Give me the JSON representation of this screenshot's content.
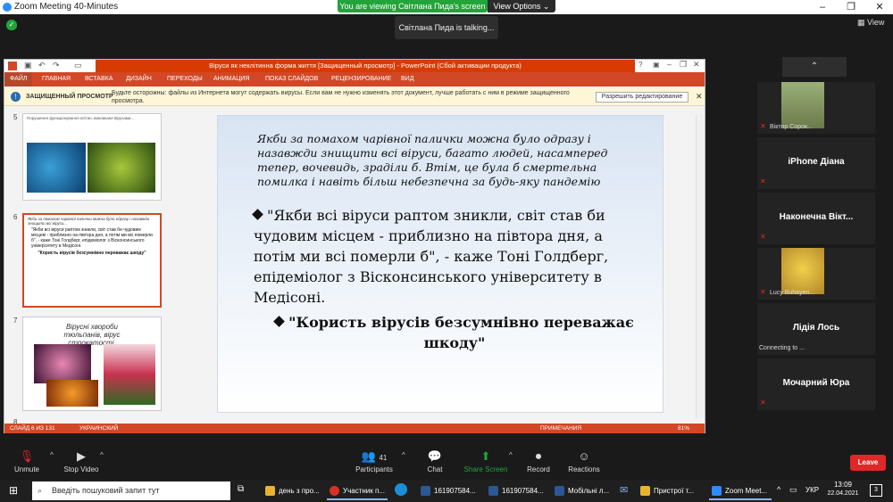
{
  "zoom": {
    "window_title": "Zoom Meeting 40-Minutes",
    "viewing_banner": "You are viewing Світлана Пида's screen",
    "view_options": "View Options",
    "talking_indicator": "Світлана Пида is talking...",
    "view_button": "View",
    "minimize": "–",
    "maximize": "❐",
    "close": "✕"
  },
  "powerpoint": {
    "title": "Віруси як неклітинна форма життя [Защищенный просмотр] - PowerPoint (Сбой активации продукта)",
    "ribbon_tabs": [
      "ФАЙЛ",
      "ГЛАВНАЯ",
      "ВСТАВКА",
      "ДИЗАЙН",
      "ПЕРЕХОДЫ",
      "АНИМАЦИЯ",
      "ПОКАЗ СЛАЙДОВ",
      "РЕЦЕНЗИРОВАНИЕ",
      "ВИД"
    ],
    "protected_view": {
      "label": "ЗАЩИЩЕННЫЙ ПРОСМОТР",
      "message": "Будьте осторожны: файлы из Интернета могут содержать вирусы. Если вам не нужно изменять этот документ, лучше работать с ним в режиме защищенного просмотра.",
      "enable_button": "Разрешить редактирование",
      "close": "✕"
    },
    "thumbnails": [
      {
        "number": "5",
        "caption": "Порушення функціонування клітин, викликане вірусами..."
      },
      {
        "number": "6",
        "caption": "Якби за помахом чарівної палички можна було одразу і назавжди знищити всі віруси...",
        "bullet1": "\"Якби всі віруси раптом зникли, світ став би чудовим місцем - приблизно на півтора дня, а потім ми всі померли б\", - каже Тоні Голдберг, епідеміолог з Вісконсинського університету в Медісоні.",
        "bullet2": "\"Користь вірусів безсумнівно переважає шкоду\""
      },
      {
        "number": "7",
        "caption": "Вірусні хвороби тюльпанів, вірус строкатості."
      },
      {
        "number": "8",
        "caption": ""
      }
    ],
    "slide": {
      "caption": "Якби за помахом чарівної палички можна було одразу і назавжди знищити всі віруси, багато людей, насамперед тепер, вочевидь, зраділи б. Втім, це була б смертельна помилка і навіть більш небезпечна за будь-яку пандемію",
      "bullet1": "\"Якби всі віруси раптом зникли, світ став би чудовим місцем - приблизно на півтора дня, а потім ми всі померли б\", - каже Тоні Голдберг, епідеміолог з Вісконсинського університету в Медісоні.",
      "bullet2": "\"Користь вірусів безсумнівно переважає шкоду\""
    },
    "status": {
      "slide_counter": "СЛАЙД 6 ИЗ 131",
      "language": "УКРАИНСКИЙ",
      "notes": "ПРИМЕЧАНИЯ",
      "zoom": "81%"
    }
  },
  "participants": [
    {
      "name": "Віктор Сорок...",
      "type": "photo"
    },
    {
      "name": "iPhone Діана",
      "type": "name"
    },
    {
      "name": "Наконечна Вікт...",
      "type": "name"
    },
    {
      "name": "Lucy Buhayen...",
      "type": "photo"
    },
    {
      "name": "Лідія Лось",
      "type": "name",
      "status": "Connecting to ..."
    },
    {
      "name": "Мочарний Юра",
      "type": "name"
    }
  ],
  "toolbar": {
    "unmute": "Unmute",
    "stop_video": "Stop Video",
    "participants": "Participants",
    "participants_count": "41",
    "chat": "Chat",
    "share_screen": "Share Screen",
    "record": "Record",
    "reactions": "Reactions",
    "leave": "Leave"
  },
  "taskbar": {
    "search_placeholder": "Введіть пошуковий запит тут",
    "items": [
      "день з про...",
      "Участник п...",
      "161907584...",
      "161907584...",
      "Мобільні л...",
      "Пристрої т...",
      "Zoom Meet..."
    ],
    "language": "УКР",
    "time": "13:09",
    "date": "22.04.2021",
    "notifications": "3"
  },
  "colors": {
    "ppt_accent": "#d24726",
    "zoom_green": "#23a43b",
    "leave_red": "#e02828"
  }
}
